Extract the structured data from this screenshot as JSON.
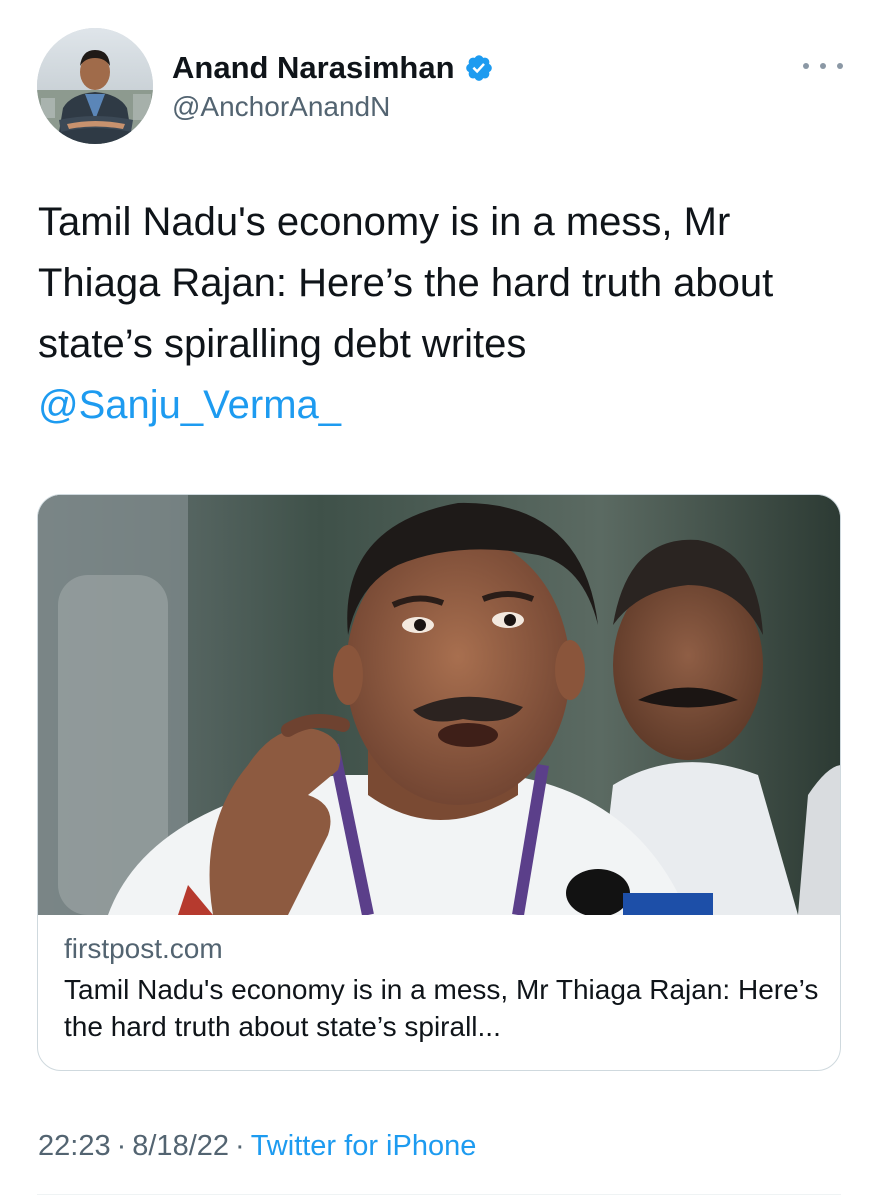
{
  "author": {
    "name": "Anand Narasimhan",
    "handle": "@AnchorAnandN",
    "verified_icon": "verified-badge-icon"
  },
  "tweet": {
    "text": "Tamil Nadu's economy is in a mess, Mr Thiaga Rajan: Here’s the hard truth about state’s spiralling debt writes ",
    "mention": "@Sanju_Verma_"
  },
  "card": {
    "domain": "firstpost.com",
    "title": "Tamil Nadu's economy is in a mess, Mr Thiaga Rajan: Here’s the hard truth about state’s spirall..."
  },
  "meta": {
    "time": "22:23",
    "date": "8/18/22",
    "separator": "·",
    "source": "Twitter for iPhone"
  },
  "colors": {
    "link": "#1d9bf0",
    "secondary_text": "#536471",
    "verified": "#1d9bf0"
  }
}
